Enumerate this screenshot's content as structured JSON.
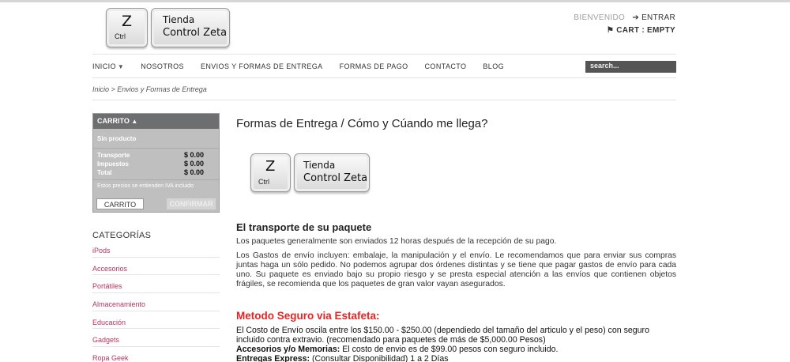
{
  "logo": {
    "key1_letter": "Z",
    "key1_small": "Ctrl",
    "key2_line1": "Tienda",
    "key2_line2": "Control Zeta"
  },
  "header": {
    "welcome": "BIENVENIDO",
    "login": "➔ ENTRAR",
    "cart": "CART : EMPTY"
  },
  "nav": {
    "items": [
      "INICIO",
      "NOSOTROS",
      "ENVIOS Y FORMAS DE ENTREGA",
      "FORMAS DE PAGO",
      "CONTACTO",
      "BLOG"
    ],
    "search_placeholder": "search..."
  },
  "breadcrumb": "Inicio > Envios y Formas de Entrega",
  "cart_box": {
    "title": "CARRITO",
    "empty": "Sin producto",
    "rows": [
      {
        "label": "Transporte",
        "value": "$ 0.00"
      },
      {
        "label": "Impuestos",
        "value": "$ 0.00"
      },
      {
        "label": "Total",
        "value": "$ 0.00"
      }
    ],
    "note": "Estos precios se entienden IVA incluido",
    "cart_button": "CARRITO",
    "confirm_button": "CONFIRMAR"
  },
  "categories": {
    "title": "CATEGORÍAS",
    "items": [
      "iPods",
      "Accesorios",
      "Portátiles",
      "Almacenamiento",
      "Educación",
      "Gadgets",
      "Ropa Geek"
    ]
  },
  "main": {
    "title": "Formas de Entrega / Cómo y Cúando me llega?",
    "section1_title": "El transporte de su paquete",
    "para1": "Los paquetes generalmente son enviados 12 horas después de la recepción de su pago.",
    "para2": "Los Gastos de envío incluyen: embalaje, la manipulación y el envío. Le recomendamos que para enviar sus compras juntas haga un sólo pedido. No podemos agrupar dos órdenes distintas y se tiene que pagar gastos de envío para cada uno. Su paquete es enviado bajo su propio riesgo y se presta especial atención a las envíos que contienen objetos frágiles, se recomienda que los paquetes de gran valor vayan asegurados.",
    "section2_title": "Metodo Seguro via Estafeta:",
    "para3": "El Costo de Envío oscila entre los $150.00 - $250.00 (dependiedo del tamaño del articulo y el peso) con seguro incluido contra extravio. (recomendado para paquetes de más de $5,000.00 Pesos)",
    "acc_label": "Accesorios y/o Memorias:",
    "acc_text": " El costo de envio es de $99.00 pesos con seguro incluido.",
    "exp_label": "Entregas Express:",
    "exp_text": " (Consultar Disponibilidad) 1 a 2 Días"
  }
}
